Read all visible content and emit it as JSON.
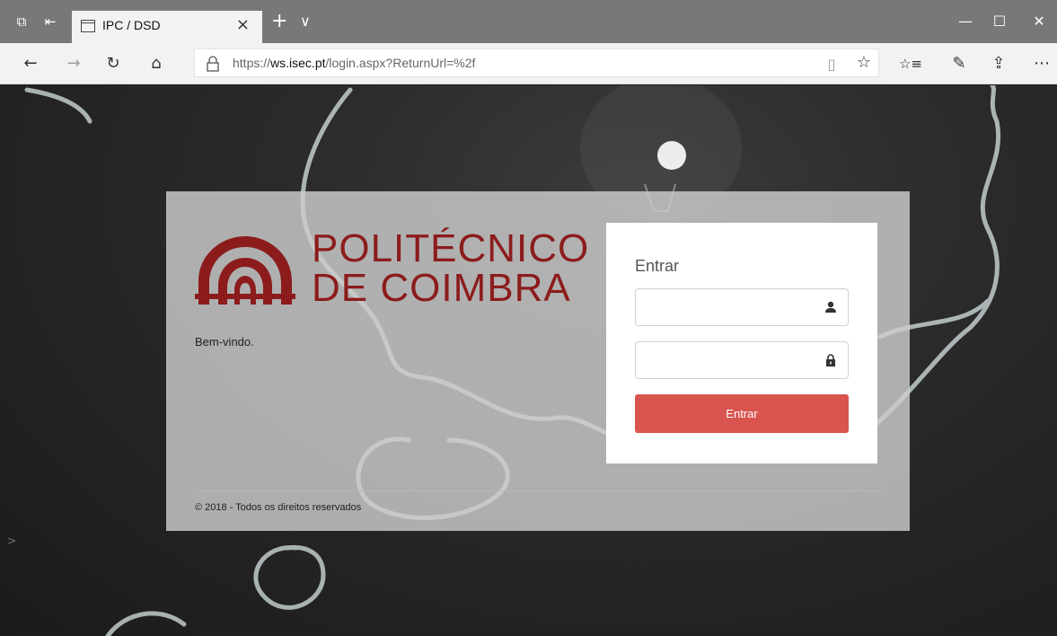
{
  "browser": {
    "tab_title": "IPC / DSD",
    "tab_close": "×",
    "new_tab": "+",
    "tab_menu": "∨",
    "url_prefix": "https://",
    "url_host": "ws.isec.pt",
    "url_path": "/login.aspx?ReturnUrl=%2f",
    "icons": {
      "set_aside": "⧉",
      "tab_preview": "⇤",
      "back": "←",
      "forward": "→",
      "refresh": "↻",
      "home": "⌂",
      "reading_view": "▯",
      "favorite": "☆",
      "favorites_hub": "☆≡",
      "notes": "✎",
      "share": "⇪",
      "more": "⋯",
      "minimize": "—",
      "maximize": "☐",
      "close": "✕"
    }
  },
  "page": {
    "logo_line1": "POLITÉCNICO",
    "logo_line2": "DE COIMBRA",
    "welcome": "Bem-vindo.",
    "copyright": "© 2018 - Todos os direitos reservados",
    "brand_color": "#8c1c1c",
    "login": {
      "title": "Entrar",
      "username_value": "",
      "password_value": "",
      "submit_label": "Entrar",
      "button_color": "#d9534f"
    },
    "side_arrow": ">"
  }
}
